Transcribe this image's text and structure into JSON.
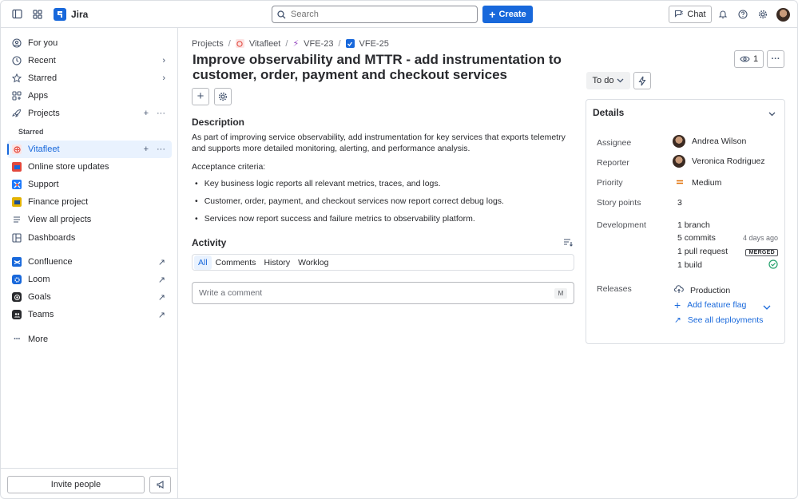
{
  "topbar": {
    "app_name": "Jira",
    "search_placeholder": "Search",
    "create_label": "Create",
    "chat_label": "Chat"
  },
  "sidebar": {
    "items": [
      {
        "label": "For you",
        "icon": "user-circle-icon"
      },
      {
        "label": "Recent",
        "icon": "clock-icon"
      },
      {
        "label": "Starred",
        "icon": "star-icon"
      },
      {
        "label": "Apps",
        "icon": "apps-icon"
      },
      {
        "label": "Projects",
        "icon": "rocket-icon"
      }
    ],
    "starred_section_label": "Starred",
    "projects": [
      {
        "label": "Vitafleet",
        "color": "#fce4e4"
      },
      {
        "label": "Online store updates",
        "color": "#e2483d"
      },
      {
        "label": "Support",
        "color": "#1d7afc"
      },
      {
        "label": "Finance project",
        "color": "#e2b203"
      }
    ],
    "view_all_label": "View all projects",
    "dashboards_label": "Dashboards",
    "apps": [
      {
        "label": "Confluence",
        "color": "#1868db"
      },
      {
        "label": "Loom",
        "color": "#1868db"
      },
      {
        "label": "Goals",
        "color": "#292a2e"
      },
      {
        "label": "Teams",
        "color": "#292a2e"
      }
    ],
    "more_label": "More",
    "invite_label": "Invite people"
  },
  "issue": {
    "breadcrumb": [
      "Projects",
      "Vitafleet",
      "VFE-23",
      "VFE-25"
    ],
    "title": "Improve observability and MTTR - add instrumentation to customer, order, payment and checkout services",
    "description_heading": "Description",
    "description": "As part of improving service observability, add instrumentation for key services that exports telemetry and supports more detailed monitoring, alerting, and performance analysis.",
    "acceptance_heading": "Acceptance criteria:",
    "criteria": [
      "Key business logic reports all relevant metrics, traces, and logs.",
      "Customer, order, payment, and checkout services now report correct debug logs.",
      "Services now report success and failure metrics to observability platform."
    ],
    "activity_heading": "Activity",
    "activity_tabs": [
      "All",
      "Comments",
      "History",
      "Worklog"
    ],
    "comment_placeholder": "Write a comment",
    "comment_shortcut": "M"
  },
  "right": {
    "watchers_count": "1",
    "status": "To do",
    "details_title": "Details",
    "assignee_label": "Assignee",
    "assignee": "Andrea Wilson",
    "reporter_label": "Reporter",
    "reporter": "Veronica Rodriguez",
    "priority_label": "Priority",
    "priority": "Medium",
    "story_points_label": "Story points",
    "story_points": "3",
    "development_label": "Development",
    "branch": "1 branch",
    "commits": "5 commits",
    "commits_time": "4 days ago",
    "pull_request": "1 pull request",
    "merged_badge": "MERGED",
    "build": "1 build",
    "releases_label": "Releases",
    "production": "Production",
    "add_feature_flag": "Add feature flag",
    "see_all_deployments": "See all deployments"
  }
}
